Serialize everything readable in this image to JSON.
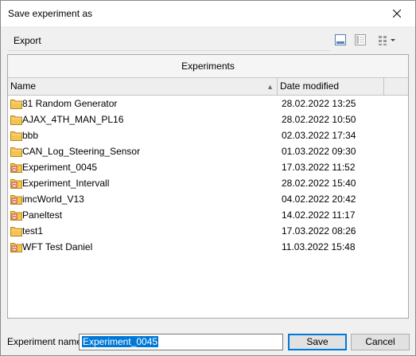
{
  "window": {
    "title": "Save experiment as"
  },
  "toolbar": {
    "export_label": "Export"
  },
  "panel": {
    "header": "Experiments",
    "columns": {
      "name": "Name",
      "date": "Date modified"
    },
    "rows": [
      {
        "name": "81 Random Generator",
        "date": "28.02.2022 13:25",
        "icon": "folder-icon"
      },
      {
        "name": "AJAX_4TH_MAN_PL16",
        "date": "28.02.2022 10:50",
        "icon": "folder-icon"
      },
      {
        "name": "bbb",
        "date": "02.03.2022 17:34",
        "icon": "folder-icon"
      },
      {
        "name": "CAN_Log_Steering_Sensor",
        "date": "01.03.2022 09:30",
        "icon": "folder-icon"
      },
      {
        "name": "Experiment_0045",
        "date": "17.03.2022 11:52",
        "icon": "experiment-folder-icon"
      },
      {
        "name": "Experiment_Intervall",
        "date": "28.02.2022 15:40",
        "icon": "experiment-folder-icon"
      },
      {
        "name": "imcWorld_V13",
        "date": "04.02.2022 20:42",
        "icon": "experiment-folder-icon"
      },
      {
        "name": "Paneltest",
        "date": "14.02.2022 11:17",
        "icon": "experiment-folder-icon"
      },
      {
        "name": "test1",
        "date": "17.03.2022 08:26",
        "icon": "folder-icon"
      },
      {
        "name": "WFT Test Daniel",
        "date": "11.03.2022 15:48",
        "icon": "experiment-folder-icon"
      }
    ]
  },
  "footer": {
    "name_label": "Experiment name",
    "name_value": "Experiment_0045",
    "save_label": "Save",
    "cancel_label": "Cancel"
  },
  "colors": {
    "accent": "#0078d7",
    "folder": "#f3c44f",
    "folder_dark": "#d9a22a",
    "experiment_mark": "#c0392b"
  }
}
